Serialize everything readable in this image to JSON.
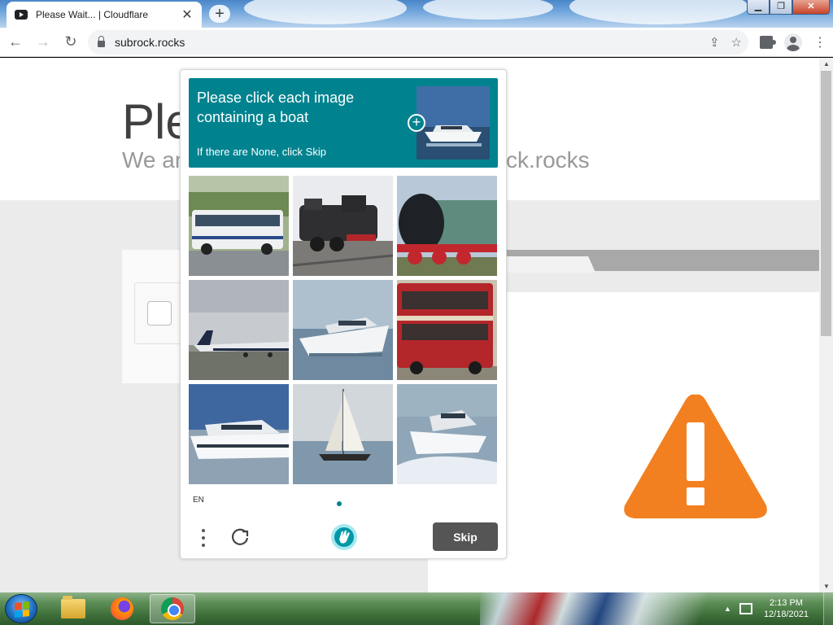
{
  "browser": {
    "tab_title": "Please Wait... | Cloudflare",
    "tab_close": "✕",
    "new_tab": "+",
    "url": "subrock.rocks",
    "back": "←",
    "forward": "→",
    "reload": "↻",
    "share": "⇪",
    "star": "☆",
    "menu": "⋮",
    "win_min": "▁",
    "win_max": "❐",
    "win_close": "✕"
  },
  "page": {
    "title": "Ple",
    "subtitle": "We ar",
    "subtitle_tail": "ck.rocks",
    "warning_color": "#f38020"
  },
  "captcha": {
    "prompt_line": "Please click each image containing a boat",
    "prompt_sub": "If there are None, click Skip",
    "language": "EN",
    "skip_label": "Skip",
    "accent": "#00838f",
    "images": [
      {
        "id": "bus",
        "label": "bus"
      },
      {
        "id": "train-1",
        "label": "steam train"
      },
      {
        "id": "train-2",
        "label": "steam train"
      },
      {
        "id": "plane",
        "label": "airplane"
      },
      {
        "id": "boat-1",
        "label": "motor yacht"
      },
      {
        "id": "double-decker",
        "label": "double-decker bus"
      },
      {
        "id": "boat-2",
        "label": "motor yacht"
      },
      {
        "id": "sailboat",
        "label": "sailboat"
      },
      {
        "id": "boat-3",
        "label": "speedboat"
      }
    ]
  },
  "taskbar": {
    "time": "2:13 PM",
    "date": "12/18/2021",
    "tray_arrow": "▲"
  }
}
